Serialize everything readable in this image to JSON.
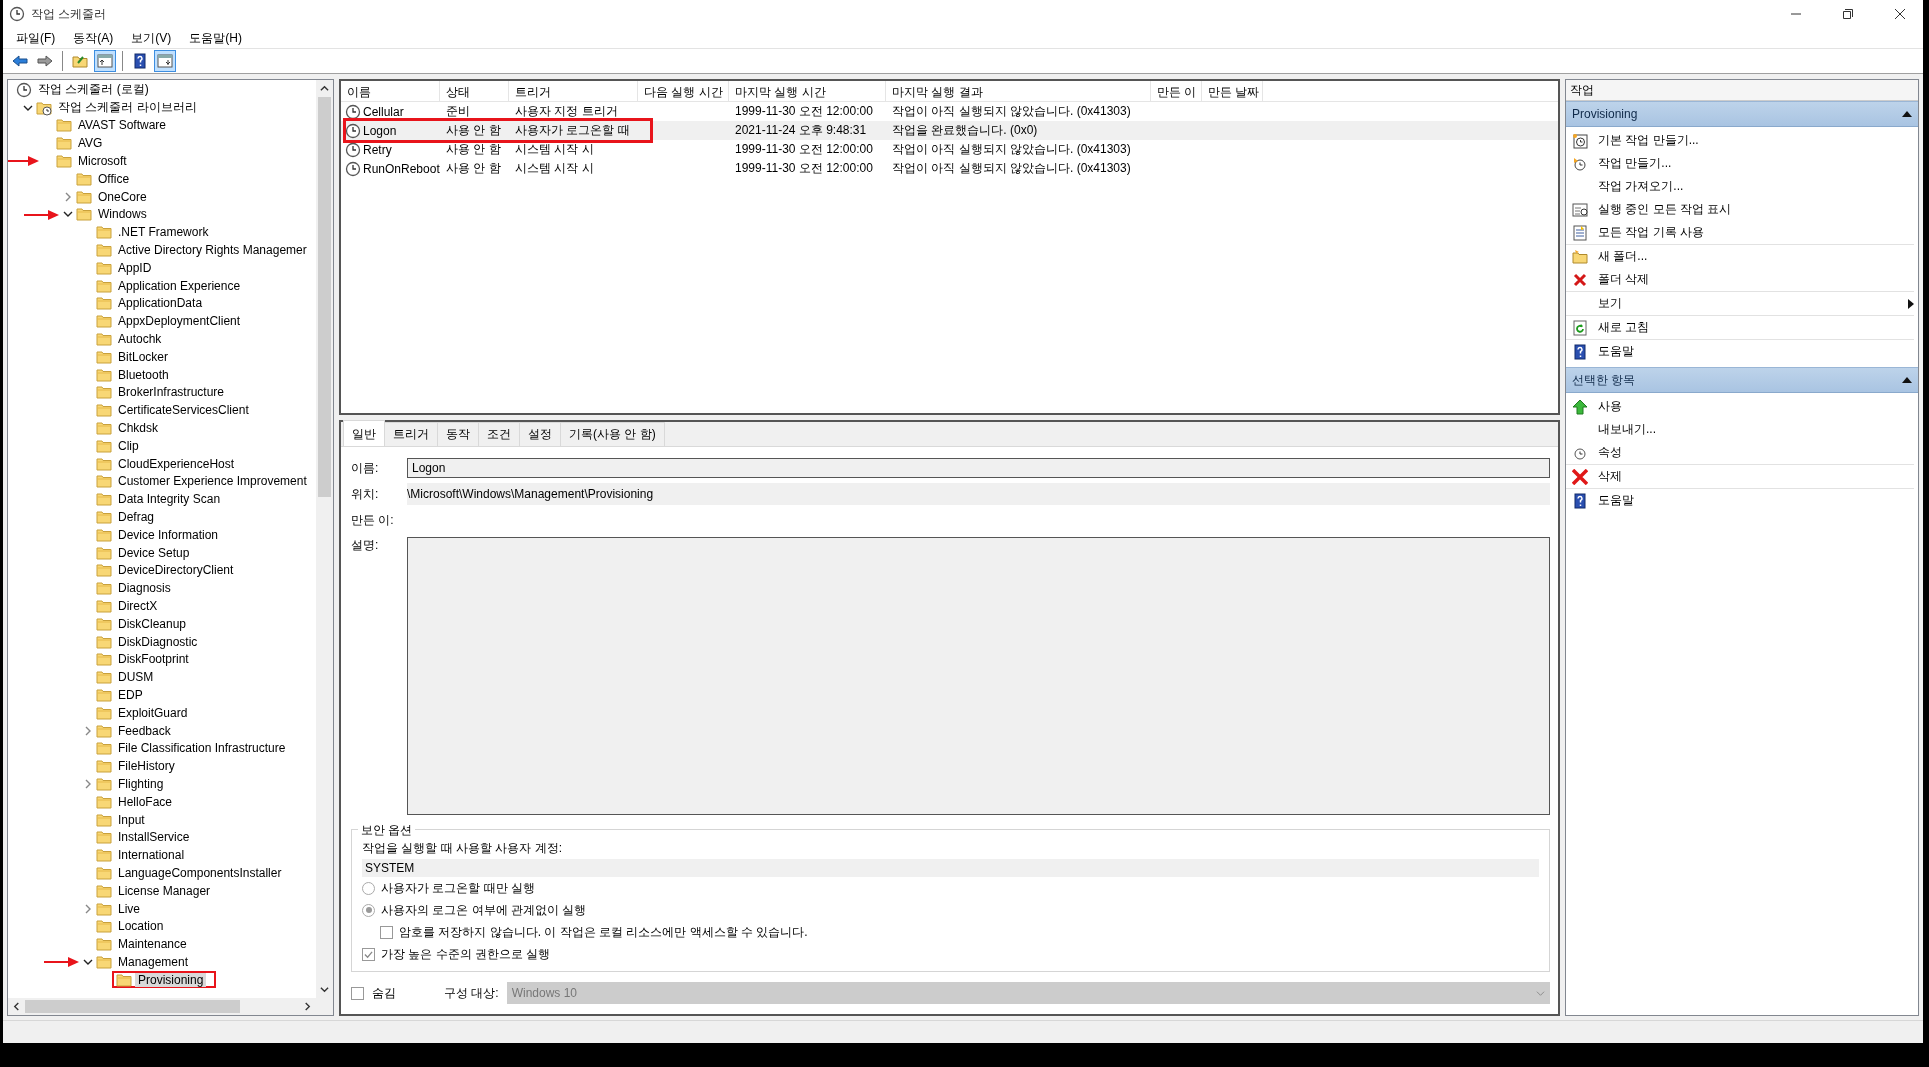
{
  "window": {
    "title": "작업 스케줄러"
  },
  "menu": [
    "파일(F)",
    "동작(A)",
    "보기(V)",
    "도움말(H)"
  ],
  "toolbar": [
    {
      "kind": "back",
      "pressed": false
    },
    {
      "kind": "forward",
      "pressed": false
    },
    {
      "kind": "separator"
    },
    {
      "kind": "folder",
      "pressed": false
    },
    {
      "kind": "tree",
      "pressed": true
    },
    {
      "kind": "separator"
    },
    {
      "kind": "help",
      "pressed": false
    },
    {
      "kind": "panel",
      "pressed": true
    }
  ],
  "tree": [
    {
      "label": "작업 스케줄러 (로컬)",
      "kind": "root",
      "selected": false,
      "children": [
        {
          "label": "작업 스케줄러 라이브러리",
          "kind": "library",
          "expanded": true,
          "selected": false,
          "children": [
            {
              "label": "AVAST Software",
              "selected": false
            },
            {
              "label": "AVG",
              "selected": false
            },
            {
              "label": "Microsoft",
              "selected": false,
              "arrow": true,
              "children": [
                {
                  "label": "Office",
                  "selected": false
                },
                {
                  "label": "OneCore",
                  "selected": false,
                  "expanded": false
                },
                {
                  "label": "Windows",
                  "selected": false,
                  "expanded": true,
                  "arrow": true,
                  "children": [
                    {
                      "label": ".NET Framework",
                      "selected": false
                    },
                    {
                      "label": "Active Directory Rights Managemer",
                      "selected": false
                    },
                    {
                      "label": "AppID",
                      "selected": false
                    },
                    {
                      "label": "Application Experience",
                      "selected": false
                    },
                    {
                      "label": "ApplicationData",
                      "selected": false
                    },
                    {
                      "label": "AppxDeploymentClient",
                      "selected": false
                    },
                    {
                      "label": "Autochk",
                      "selected": false
                    },
                    {
                      "label": "BitLocker",
                      "selected": false
                    },
                    {
                      "label": "Bluetooth",
                      "selected": false
                    },
                    {
                      "label": "BrokerInfrastructure",
                      "selected": false
                    },
                    {
                      "label": "CertificateServicesClient",
                      "selected": false
                    },
                    {
                      "label": "Chkdsk",
                      "selected": false
                    },
                    {
                      "label": "Clip",
                      "selected": false
                    },
                    {
                      "label": "CloudExperienceHost",
                      "selected": false
                    },
                    {
                      "label": "Customer Experience Improvement",
                      "selected": false
                    },
                    {
                      "label": "Data Integrity Scan",
                      "selected": false
                    },
                    {
                      "label": "Defrag",
                      "selected": false
                    },
                    {
                      "label": "Device Information",
                      "selected": false
                    },
                    {
                      "label": "Device Setup",
                      "selected": false
                    },
                    {
                      "label": "DeviceDirectoryClient",
                      "selected": false
                    },
                    {
                      "label": "Diagnosis",
                      "selected": false
                    },
                    {
                      "label": "DirectX",
                      "selected": false
                    },
                    {
                      "label": "DiskCleanup",
                      "selected": false
                    },
                    {
                      "label": "DiskDiagnostic",
                      "selected": false
                    },
                    {
                      "label": "DiskFootprint",
                      "selected": false
                    },
                    {
                      "label": "DUSM",
                      "selected": false
                    },
                    {
                      "label": "EDP",
                      "selected": false
                    },
                    {
                      "label": "ExploitGuard",
                      "selected": false
                    },
                    {
                      "label": "Feedback",
                      "selected": false,
                      "expanded": false
                    },
                    {
                      "label": "File Classification Infrastructure",
                      "selected": false
                    },
                    {
                      "label": "FileHistory",
                      "selected": false
                    },
                    {
                      "label": "Flighting",
                      "selected": false,
                      "expanded": false
                    },
                    {
                      "label": "HelloFace",
                      "selected": false
                    },
                    {
                      "label": "Input",
                      "selected": false
                    },
                    {
                      "label": "InstallService",
                      "selected": false
                    },
                    {
                      "label": "International",
                      "selected": false
                    },
                    {
                      "label": "LanguageComponentsInstaller",
                      "selected": false
                    },
                    {
                      "label": "License Manager",
                      "selected": false
                    },
                    {
                      "label": "Live",
                      "selected": false,
                      "expanded": false
                    },
                    {
                      "label": "Location",
                      "selected": false
                    },
                    {
                      "label": "Maintenance",
                      "selected": false
                    },
                    {
                      "label": "Management",
                      "selected": false,
                      "expanded": true,
                      "arrow": true,
                      "children": [
                        {
                          "label": "Provisioning",
                          "selected": true,
                          "boxed": true
                        }
                      ]
                    }
                  ]
                }
              ]
            }
          ]
        }
      ]
    }
  ],
  "task_list": {
    "columns": [
      "이름",
      "상태",
      "트리거",
      "다음 실행 시간",
      "마지막 실행 시간",
      "마지막 실행 결과",
      "만든 이",
      "만든 날짜"
    ],
    "rows": [
      {
        "name": "Cellular",
        "status": "준비",
        "trigger": "사용자 지정 트리거",
        "last_run_time": "1999-11-30 오전 12:00:00",
        "last_run_result": "작업이 아직 실행되지 않았습니다. (0x41303)",
        "selected": false
      },
      {
        "name": "Logon",
        "status": "사용 안 함",
        "trigger": "사용자가 로그온할 때",
        "last_run_time": "2021-11-24 오후 9:48:31",
        "last_run_result": "작업을 완료했습니다. (0x0)",
        "selected": true,
        "highlighted": true
      },
      {
        "name": "Retry",
        "status": "사용 안 함",
        "trigger": "시스템 시작 시",
        "last_run_time": "1999-11-30 오전 12:00:00",
        "last_run_result": "작업이 아직 실행되지 않았습니다. (0x41303)",
        "selected": false
      },
      {
        "name": "RunOnReboot",
        "status": "사용 안 함",
        "trigger": "시스템 시작 시",
        "last_run_time": "1999-11-30 오전 12:00:00",
        "last_run_result": "작업이 아직 실행되지 않았습니다. (0x41303)",
        "selected": false
      }
    ]
  },
  "details": {
    "tabs": [
      {
        "label": "일반",
        "selected": true
      },
      {
        "label": "트리거",
        "selected": false
      },
      {
        "label": "동작",
        "selected": false
      },
      {
        "label": "조건",
        "selected": false
      },
      {
        "label": "설정",
        "selected": false
      },
      {
        "label": "기록(사용 안 함)",
        "selected": false
      }
    ],
    "name_label": "이름:",
    "name_value": "Logon",
    "location_label": "위치:",
    "location_value": "\\Microsoft\\Windows\\Management\\Provisioning",
    "author_label": "만든 이:",
    "description_label": "설명:",
    "security": {
      "title": "보안 옵션",
      "account_label": "작업을 실행할 때 사용할 사용자 계정:",
      "account_value": "SYSTEM",
      "options": [
        {
          "kind": "radio",
          "label": "사용자가 로그온할 때만 실행",
          "selected": false
        },
        {
          "kind": "radio",
          "label": "사용자의 로그온 여부에 관계없이 실행",
          "selected": true,
          "children": [
            {
              "kind": "checkbox",
              "label": "암호를 저장하지 않습니다. 이 작업은 로컬 리소스에만 액세스할 수 있습니다.",
              "checked": false
            }
          ]
        },
        {
          "kind": "checkbox",
          "label": "가장 높은 수준의 권한으로 실행",
          "checked": true
        }
      ]
    },
    "hidden": {
      "label": "숨김",
      "checked": false
    },
    "configure_label": "구성 대상:",
    "configure_value": "Windows 10"
  },
  "actions_pane": {
    "title": "작업",
    "sections": [
      {
        "title": "Provisioning",
        "expanded": true,
        "items": [
          {
            "label": "기본 작업 만들기..."
          },
          {
            "label": "작업 만들기..."
          },
          {
            "label": "작업 가져오기..."
          },
          {
            "label": "실행 중인 모든 작업 표시"
          },
          {
            "label": "모든 작업 기록 사용",
            "separator_after": true
          },
          {
            "label": "새 폴더..."
          },
          {
            "label": "폴더 삭제",
            "separator_after": true
          },
          {
            "label": "보기",
            "submenu": true,
            "separator_after": true
          },
          {
            "label": "새로 고침",
            "separator_after": true
          },
          {
            "label": "도움말"
          }
        ]
      },
      {
        "title": "선택한 항목",
        "expanded": true,
        "items": [
          {
            "label": "사용"
          },
          {
            "label": "내보내기..."
          },
          {
            "label": "속성",
            "separator_after": true
          },
          {
            "label": "삭제",
            "separator_after": true
          },
          {
            "label": "도움말"
          }
        ]
      }
    ]
  }
}
